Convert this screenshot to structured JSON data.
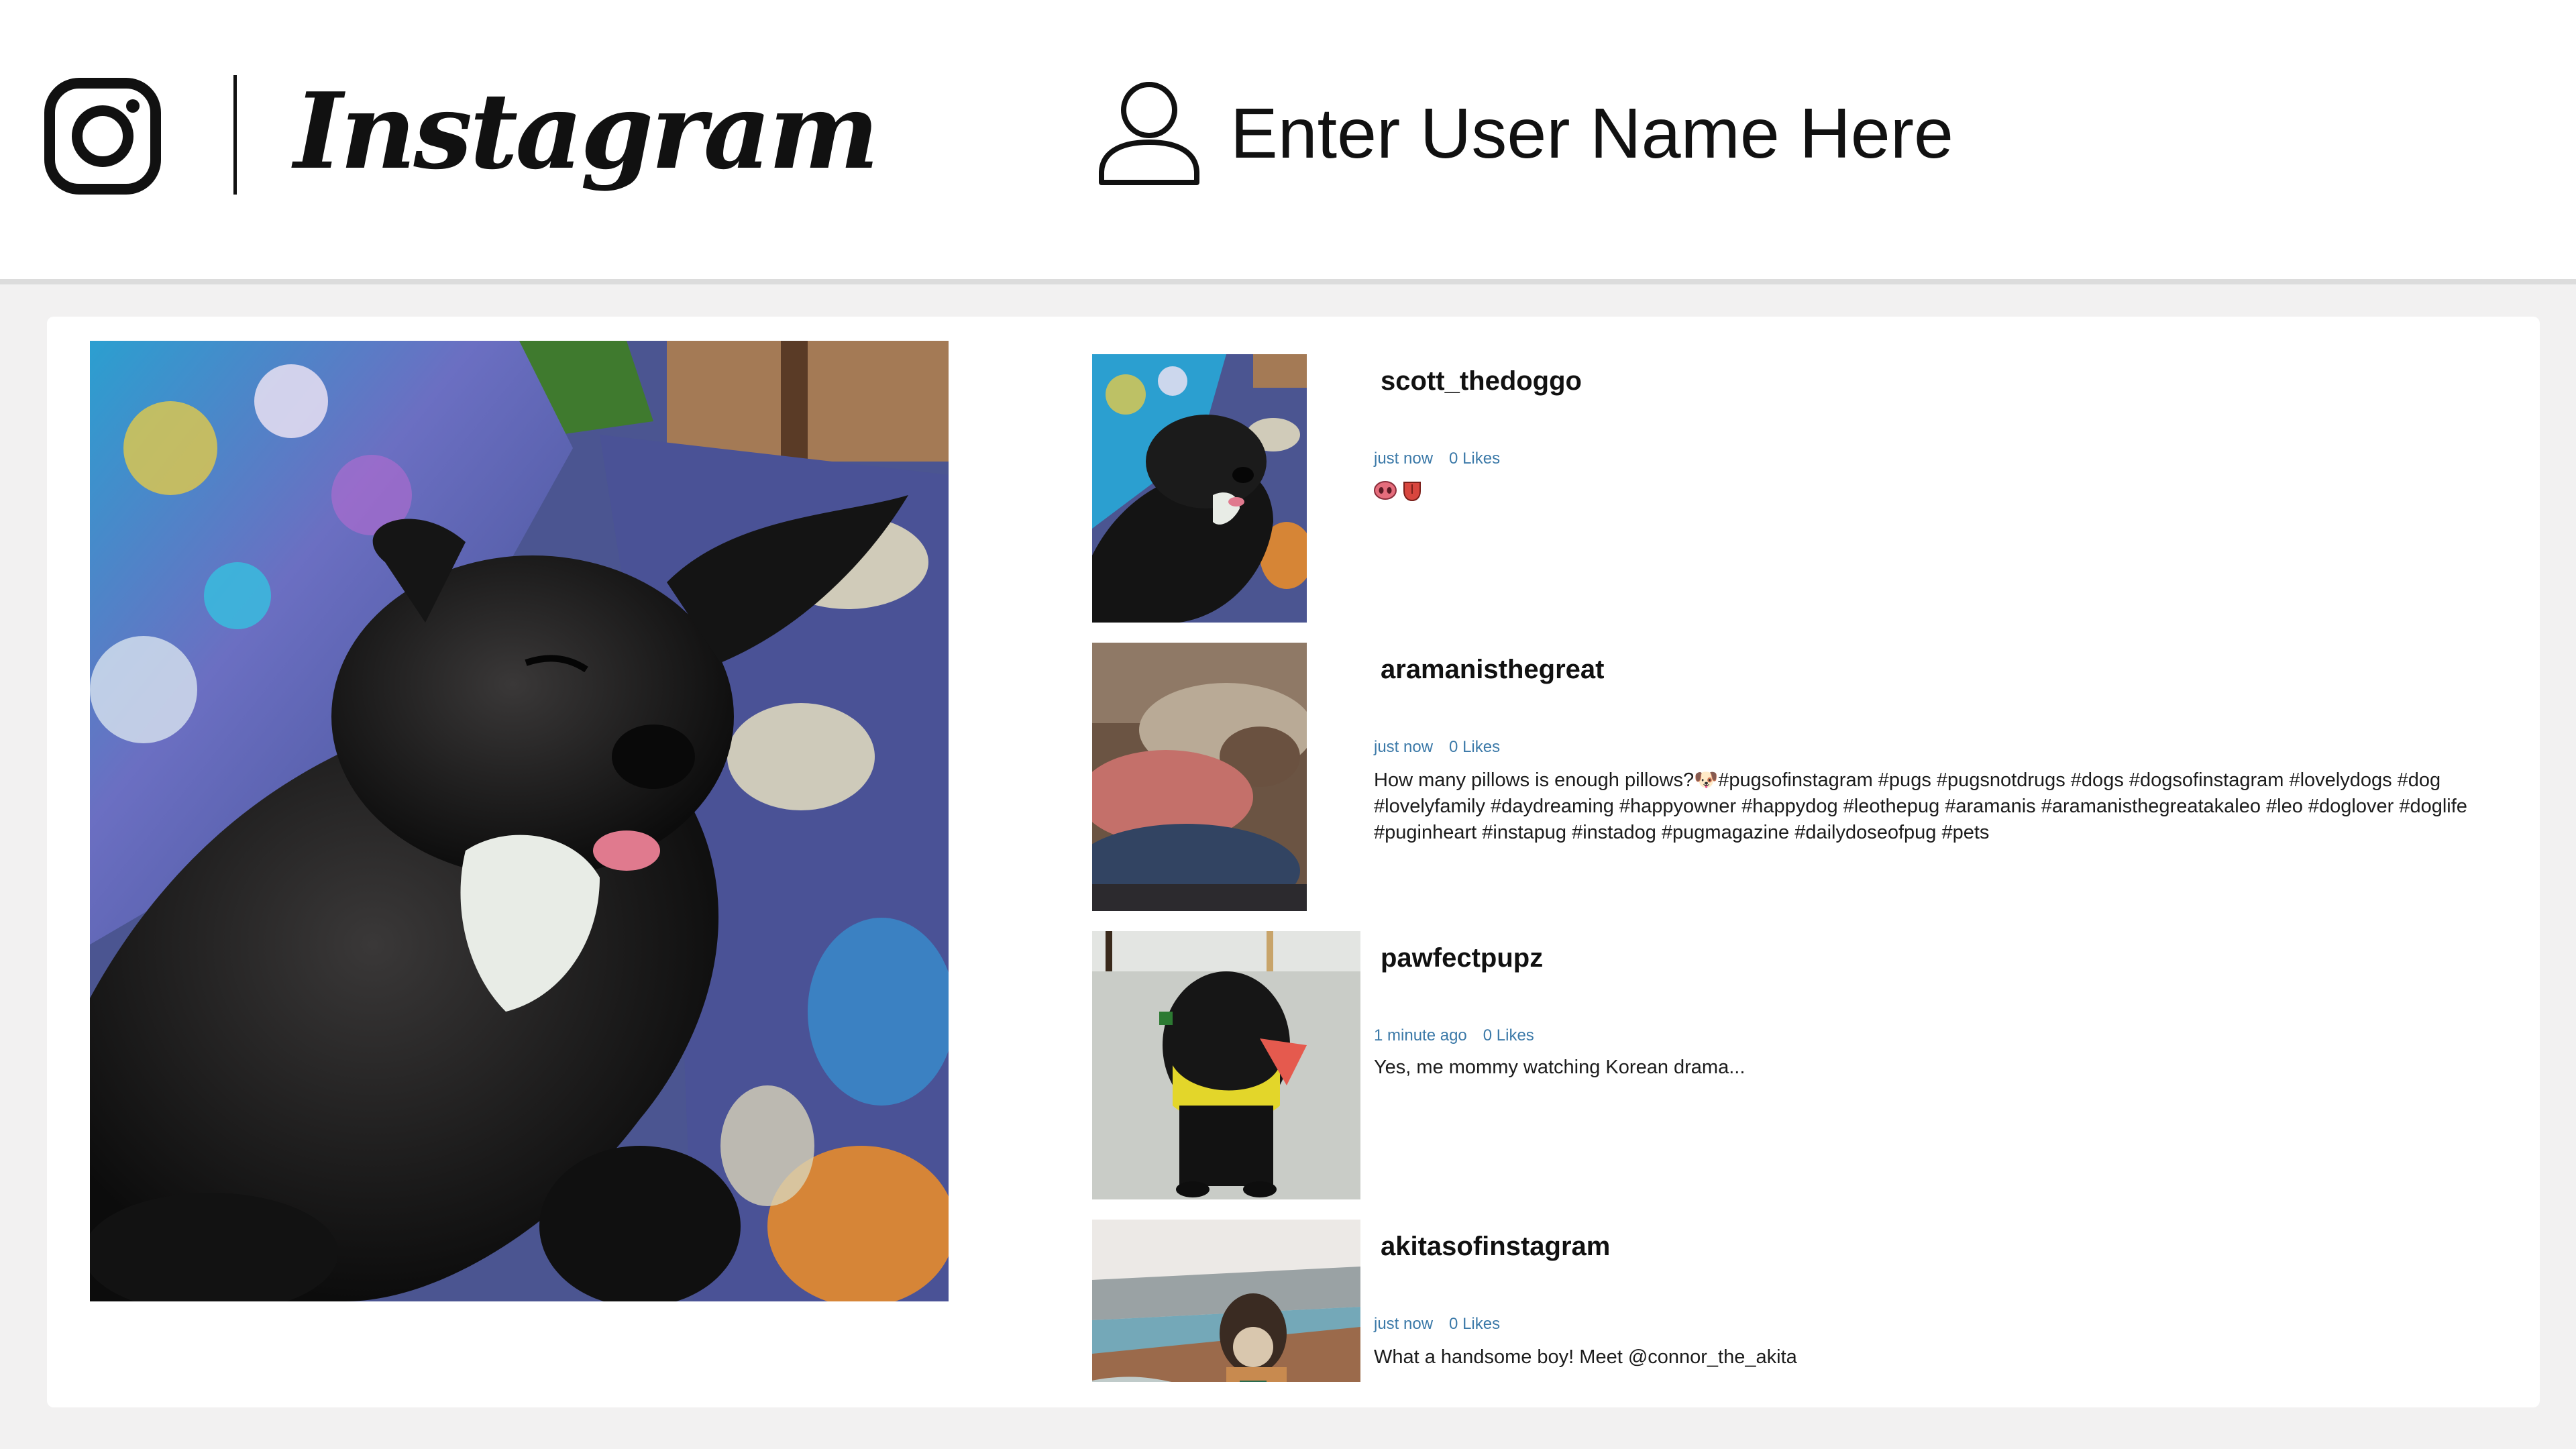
{
  "header": {
    "app_name": "Instagram",
    "user_name": "Enter User Name Here"
  },
  "colors": {
    "meta_text": "#3b79a8",
    "panel_background": "#ffffff",
    "page_background": "#f2f1f1"
  },
  "feed": {
    "posts": [
      {
        "username": "scott_thedoggo",
        "time": "just now",
        "likes": "0 Likes",
        "caption": "",
        "caption_icons": [
          "pig-nose-icon",
          "tongue-icon"
        ]
      },
      {
        "username": "aramanisthegreat",
        "time": "just now",
        "likes": "0 Likes",
        "caption": "How many pillows is enough pillows?🐶#pugsofinstagram #pugs #pugsnotdrugs #dogs #dogsofinstagram #lovelydogs #dog #lovelyfamily #daydreaming #happyowner #happydog #leothepug #aramanis #aramanisthegreatakaleo #leo #doglover #doglife #puginheart #instapug #instadog #pugmagazine #dailydoseofpug #pets"
      },
      {
        "username": "pawfectpupz",
        "time": "1 minute ago",
        "likes": "0 Likes",
        "caption": "Yes, me mommy watching Korean drama..."
      },
      {
        "username": "akitasofinstagram",
        "time": "just now",
        "likes": "0 Likes",
        "caption": "What a handsome boy! Meet @connor_the_akita"
      }
    ]
  }
}
